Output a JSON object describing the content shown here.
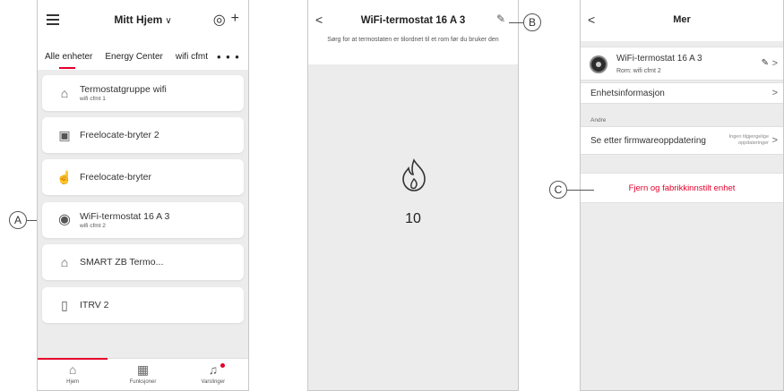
{
  "phone1": {
    "title": "Mitt Hjem",
    "tabs": [
      "Alle enheter",
      "Energy Center",
      "wifi cfmt"
    ],
    "more": "• • •",
    "devices": [
      {
        "name": "Termostatgruppe wifi",
        "sub": "wifi cfmt 1",
        "icon": "thermostat-group-icon"
      },
      {
        "name": "Freelocate-bryter 2",
        "sub": "",
        "icon": "switch-icon"
      },
      {
        "name": "Freelocate-bryter",
        "sub": "",
        "icon": "touch-switch-icon"
      },
      {
        "name": "WiFi-termostat 16 A 3",
        "sub": "wifi cfmt 2",
        "icon": "wifi-thermostat-icon"
      },
      {
        "name": "SMART ZB Termo...",
        "sub": "",
        "icon": "thermostat-icon"
      },
      {
        "name": "ITRV 2",
        "sub": "",
        "icon": "radiator-valve-icon"
      }
    ],
    "nav": [
      "Hjem",
      "Funksjoner",
      "Varslinger"
    ]
  },
  "phone2": {
    "title": "WiFi-termostat 16 A 3",
    "notice": "Sørg for at termostaten er tilordnet til et rom før du bruker den",
    "temperature": "10"
  },
  "phone3": {
    "title": "Mer",
    "device_name": "WiFi-termostat 16 A 3",
    "room": "Rom: wifi cfmt 2",
    "device_info": "Enhetsinformasjon",
    "section": "Andre",
    "firmware": "Se etter firmwareoppdatering",
    "firmware_note_1": "Ingen tilgjengelige",
    "firmware_note_2": "oppdateringer",
    "reset": "Fjern og fabrikkinnstilt enhet"
  },
  "callouts": {
    "a": "A",
    "b": "B",
    "c": "C"
  },
  "colors": {
    "accent": "#e4002b",
    "background": "#ececec"
  }
}
